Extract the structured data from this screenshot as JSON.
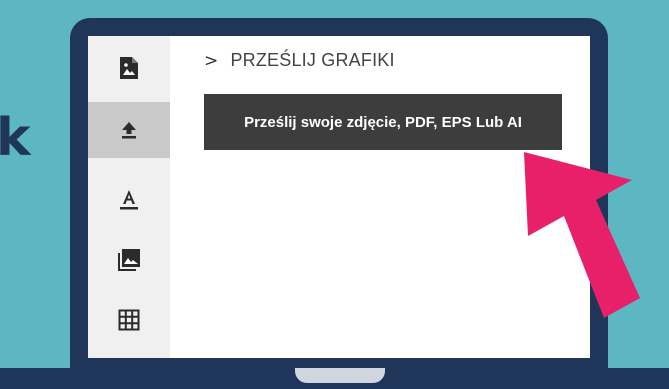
{
  "background_glyph": "k",
  "sidebar": {
    "items": [
      {
        "name": "image-upload",
        "icon": "image-file-icon",
        "active": false
      },
      {
        "name": "upload",
        "icon": "upload-icon",
        "active": true
      },
      {
        "name": "text",
        "icon": "text-format-icon",
        "active": false
      },
      {
        "name": "gallery",
        "icon": "photo-library-icon",
        "active": false
      },
      {
        "name": "grid",
        "icon": "grid-icon",
        "active": false
      }
    ]
  },
  "main": {
    "breadcrumb_chevron": ">",
    "breadcrumb_label": "PRZEŚLIJ GRAFIKI",
    "tooltip_text": "Prześlij swoje zdjęcie, PDF, EPS Lub AI"
  },
  "colors": {
    "background": "#5db7c3",
    "laptop_frame": "#1f3559",
    "arrow": "#e8206a",
    "tooltip_bg": "#3d3d3d",
    "sidebar_active": "#c9c9c9"
  }
}
